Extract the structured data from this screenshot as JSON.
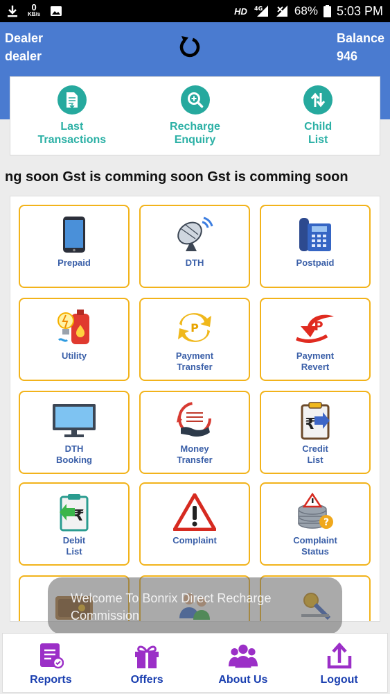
{
  "status_bar": {
    "download_speed": "0",
    "speed_unit": "KB/s",
    "network_type": "HD",
    "signal_gen": "4G",
    "battery": "68%",
    "time": "5:03 PM"
  },
  "header": {
    "user_role": "Dealer",
    "username": "dealer",
    "balance_label": "Balance",
    "balance_value": "946"
  },
  "quick_actions": [
    {
      "line1": "Last",
      "line2": "Transactions"
    },
    {
      "line1": "Recharge",
      "line2": "Enquiry"
    },
    {
      "line1": "Child",
      "line2": "List"
    }
  ],
  "marquee_text": "ng soon Gst is comming soon Gst is comming soon",
  "services": [
    {
      "line1": "Prepaid",
      "line2": ""
    },
    {
      "line1": "DTH",
      "line2": ""
    },
    {
      "line1": "Postpaid",
      "line2": ""
    },
    {
      "line1": "Utility",
      "line2": ""
    },
    {
      "line1": "Payment",
      "line2": "Transfer"
    },
    {
      "line1": "Payment",
      "line2": "Revert"
    },
    {
      "line1": "DTH",
      "line2": "Booking"
    },
    {
      "line1": "Money",
      "line2": "Transfer"
    },
    {
      "line1": "Credit",
      "line2": "List"
    },
    {
      "line1": "Debit",
      "line2": "List"
    },
    {
      "line1": "Complaint",
      "line2": ""
    },
    {
      "line1": "Complaint",
      "line2": "Status"
    }
  ],
  "toast": {
    "line1": "Welcome To Bonrix Direct Recharge",
    "line2": "Commission"
  },
  "bottom_nav": [
    {
      "label": "Reports"
    },
    {
      "label": "Offers"
    },
    {
      "label": "About Us"
    },
    {
      "label": "Logout"
    }
  ],
  "colors": {
    "header_blue": "#4a7bd0",
    "teal": "#26a99e",
    "tile_border": "#f2b31b",
    "tile_label": "#3a5fa8",
    "nav_purple": "#9b2fc7",
    "nav_label": "#1a3fb0"
  }
}
